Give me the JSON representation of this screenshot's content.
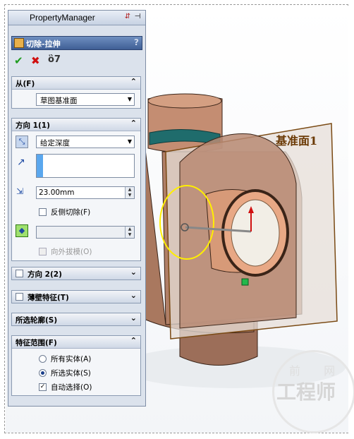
{
  "property_manager": {
    "title": "PropertyManager",
    "feature_name": "切除-拉伸",
    "help_label": "?",
    "from": {
      "header": "从(F)",
      "collapse_glyph": "⌃",
      "start_condition": "草图基准面"
    },
    "direction1": {
      "header": "方向 1(1)",
      "collapse_glyph": "⌃",
      "end_condition": "给定深度",
      "depth": "23.00mm",
      "flip_side_label": "反侧切除(F)",
      "flip_side_checked": false,
      "draft_value": "",
      "draft_outward_label": "向外拔模(O)",
      "draft_outward_checked": false
    },
    "direction2": {
      "header": "方向 2(2)",
      "expand_glyph": "⌄",
      "checked": false
    },
    "thin_feature": {
      "header": "薄壁特征(T)",
      "expand_glyph": "⌄",
      "checked": false
    },
    "selected_contours": {
      "header": "所选轮廓(S)",
      "expand_glyph": "⌄"
    },
    "feature_scope": {
      "header": "特征范围(F)",
      "collapse_glyph": "⌃",
      "options": [
        {
          "label": "所有实体(A)",
          "selected": false
        },
        {
          "label": "所选实体(S)",
          "selected": true
        }
      ],
      "auto_select_label": "自动选择(O)",
      "auto_select_checked": true
    }
  },
  "viewport": {
    "plane_label": "基准面1",
    "watermark_top": "前 网",
    "watermark": "工程师"
  },
  "colors": {
    "body": "#b7866f",
    "plane": "#e0d4ca",
    "plane_edge": "#7a4a14",
    "ring": "#1f6c6c",
    "circle_preview": "#ffef00"
  }
}
